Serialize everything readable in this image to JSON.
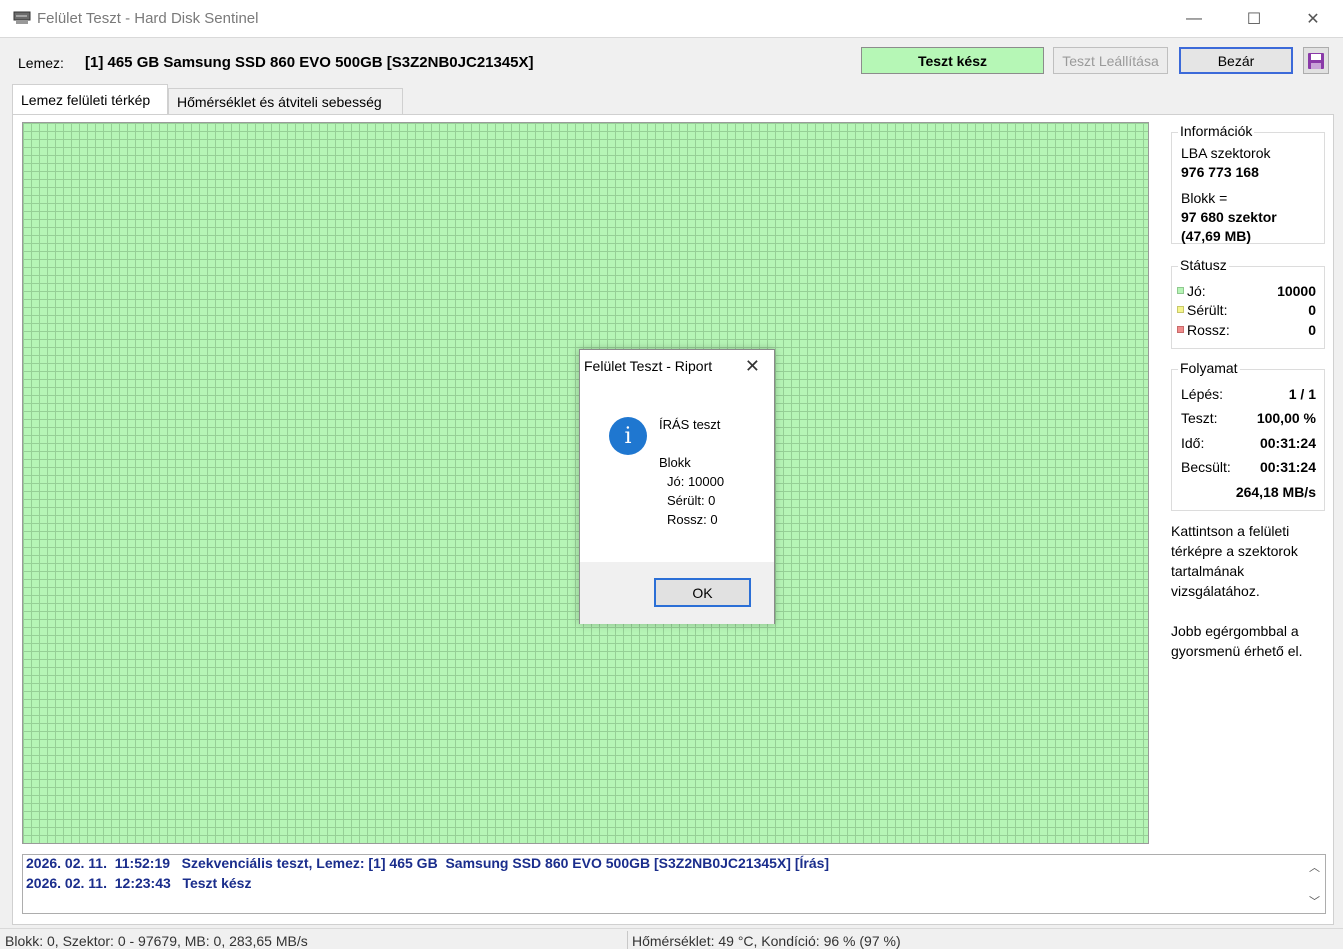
{
  "window": {
    "title": "Felület Teszt - Hard Disk Sentinel",
    "minimize": "—",
    "maximize": "☐",
    "close": "✕"
  },
  "toolbar": {
    "disk_label": "Lemez:",
    "disk_name": "[1] 465 GB  Samsung SSD 860 EVO 500GB [S3Z2NB0JC21345X]",
    "status": "Teszt kész",
    "status_color": "#b6f7b6",
    "stop_button": "Teszt Leállítása",
    "close_button": "Bezár"
  },
  "tabs": [
    {
      "label": "Lemez felületi térkép",
      "active": true
    },
    {
      "label": "Hőmérséklet és átviteli sebesség",
      "active": false
    }
  ],
  "info": {
    "title": "Információk",
    "lba_label": "LBA szektorok",
    "lba_value": "976 773 168",
    "block_label": "Blokk =",
    "block_value": "97 680 szektor",
    "block_size": "(47,69 MB)"
  },
  "status": {
    "title": "Státusz",
    "good_label": "Jó:",
    "good_value": "10000",
    "damaged_label": "Sérült:",
    "damaged_value": "0",
    "bad_label": "Rossz:",
    "bad_value": "0",
    "good_color": "#b6f5b6",
    "damaged_color": "#f5f58c",
    "bad_color": "#f08c8c"
  },
  "progress": {
    "title": "Folyamat",
    "step_label": "Lépés:",
    "step_value": "1 / 1",
    "test_label": "Teszt:",
    "test_value": "100,00 %",
    "time_label": "Idő:",
    "time_value": "00:31:24",
    "est_label": "Becsült:",
    "est_value": "00:31:24",
    "speed": "264,18 MB/s"
  },
  "help": {
    "line1": "Kattintson a felületi térképre a szektorok tartalmának vizsgálatához.",
    "line2": "Jobb egérgombbal a gyorsmenü érhető el."
  },
  "log": [
    "2026. 02. 11.  11:52:19   Szekvenciális teszt, Lemez: [1] 465 GB  Samsung SSD 860 EVO 500GB [S3Z2NB0JC21345X] [Írás]",
    "2026. 02. 11.  12:23:43   Teszt kész"
  ],
  "statusbar": {
    "left": "Blokk: 0, Szektor: 0 - 97679, MB: 0, 283,65 MB/s",
    "right": "Hőmérséklet: 49  °C,  Kondíció: 96 % (97 %)"
  },
  "dialog": {
    "title": "Felület Teszt - Riport",
    "heading": "ÍRÁS teszt",
    "block_label": "Blokk",
    "good": "Jó: 10000",
    "damaged": "Sérült: 0",
    "bad": "Rossz: 0",
    "ok": "OK"
  }
}
